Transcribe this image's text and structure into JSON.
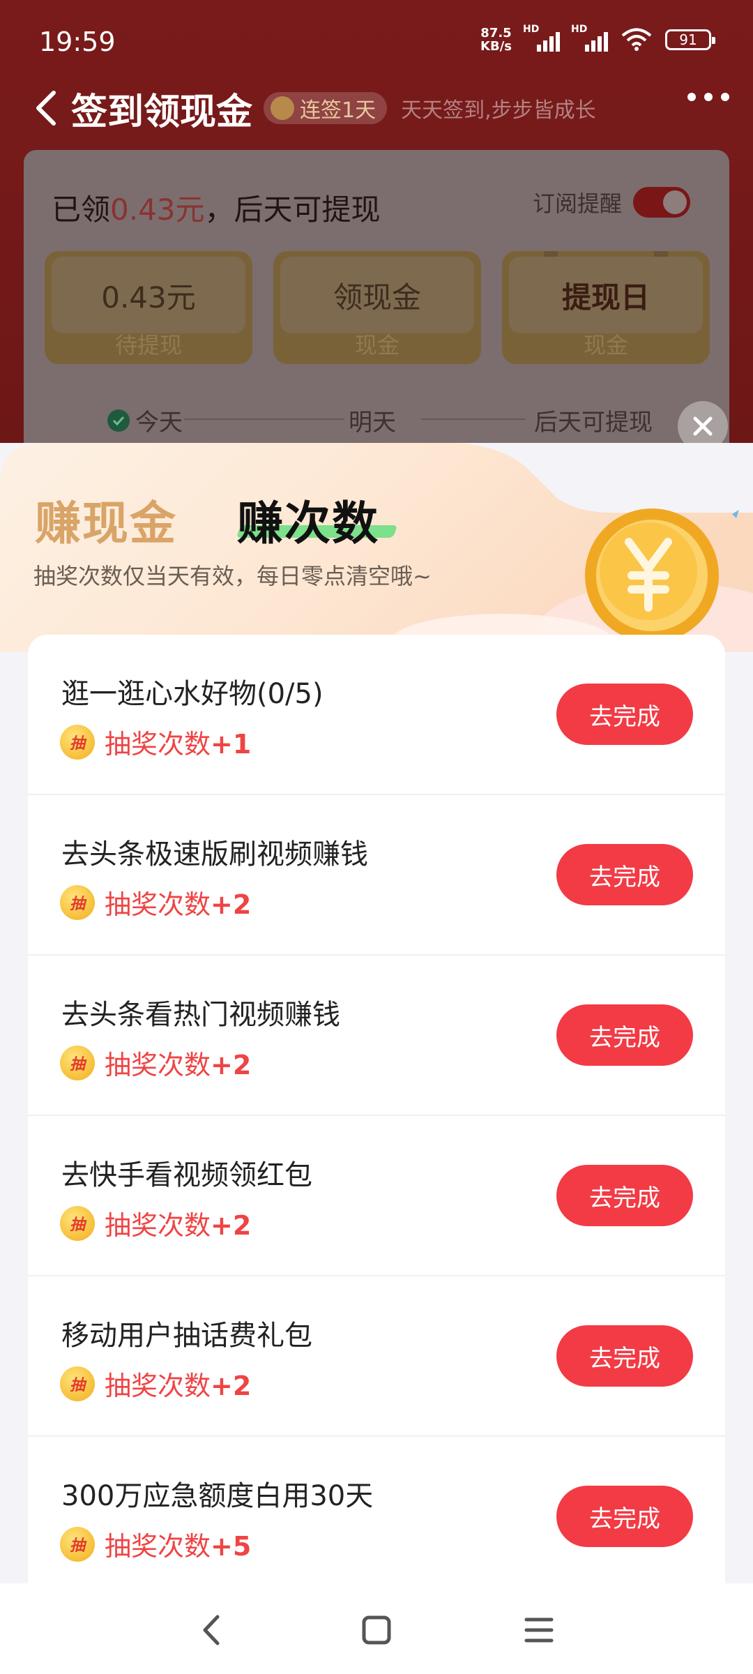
{
  "status_bar": {
    "time": "19:59",
    "net_speed_value": "87.5",
    "net_speed_unit": "KB/s",
    "sim1_tag": "HD",
    "sim2_tag": "HD",
    "battery": "91"
  },
  "header": {
    "title": "签到领现金",
    "streak_badge": "连签1天",
    "slogan": "天天签到,步步皆成长"
  },
  "checkin_card": {
    "summary_prefix": "已领",
    "summary_amount": "0.43元",
    "summary_suffix": "，后天可提现",
    "subscribe_label": "订阅提醒",
    "boxes": [
      {
        "top": "0.43元",
        "bottom": "待提现"
      },
      {
        "top": "领现金",
        "bottom": "现金"
      },
      {
        "top": "提现日",
        "bottom": "现金"
      }
    ],
    "timeline": [
      "今天",
      "明天",
      "后天可提现"
    ]
  },
  "sheet": {
    "tab_cash": "赚现金",
    "tab_count": "赚次数",
    "note": "抽奖次数仅当天有效，每日零点清空哦~",
    "reward_icon_char": "抽",
    "tasks": [
      {
        "title": "逛一逛心水好物(0/5)",
        "reward_label": "抽奖次数",
        "reward_value": "+1",
        "button": "去完成"
      },
      {
        "title": "去头条极速版刷视频赚钱",
        "reward_label": "抽奖次数",
        "reward_value": "+2",
        "button": "去完成"
      },
      {
        "title": "去头条看热门视频赚钱",
        "reward_label": "抽奖次数",
        "reward_value": "+2",
        "button": "去完成"
      },
      {
        "title": "去快手看视频领红包",
        "reward_label": "抽奖次数",
        "reward_value": "+2",
        "button": "去完成"
      },
      {
        "title": "移动用户抽话费礼包",
        "reward_label": "抽奖次数",
        "reward_value": "+2",
        "button": "去完成"
      },
      {
        "title": "300万应急额度白用30天",
        "reward_label": "抽奖次数",
        "reward_value": "+5",
        "button": "去完成"
      }
    ]
  },
  "colors": {
    "accent_red": "#f23b45",
    "reward_red": "#ef4444",
    "tab_gold": "#d9a467",
    "tab_highlight": "#7de08a"
  },
  "icons": [
    "back-arrow-icon",
    "more-dots-icon",
    "close-icon",
    "coin-yen-icon",
    "reward-draw-icon",
    "nav-back-icon",
    "nav-home-icon",
    "nav-menu-icon"
  ]
}
